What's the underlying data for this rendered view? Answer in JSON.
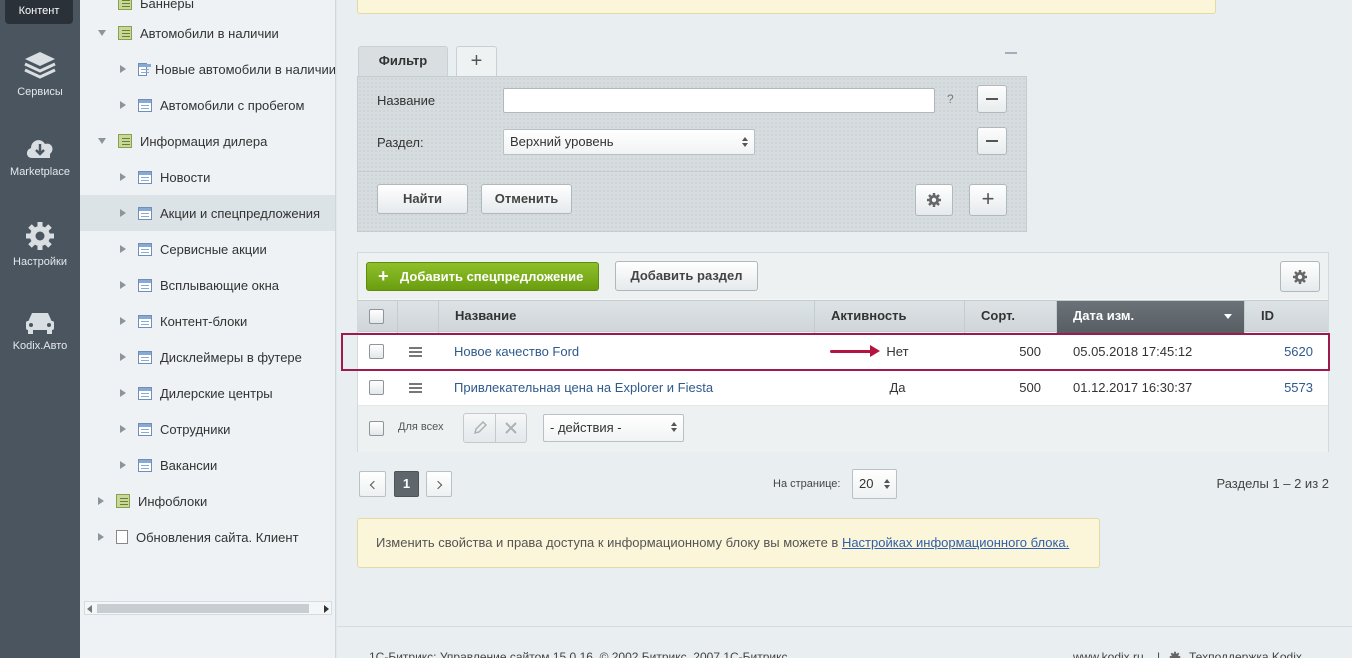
{
  "rail": {
    "active_label": "Контент",
    "items": [
      {
        "label": "Сервисы",
        "icon": "layers-icon"
      },
      {
        "label": "Marketplace",
        "icon": "cloud-download-icon"
      },
      {
        "label": "Настройки",
        "icon": "gear-icon"
      },
      {
        "label": "Kodix.Авто",
        "icon": "car-icon"
      }
    ]
  },
  "tree": {
    "items": [
      {
        "label": "Баннеры"
      },
      {
        "label": "Автомобили в наличии"
      },
      {
        "label": "Новые автомобили в наличии"
      },
      {
        "label": "Автомобили с пробегом"
      },
      {
        "label": "Информация дилера"
      },
      {
        "label": "Новости"
      },
      {
        "label": "Акции и спецпредложения"
      },
      {
        "label": "Сервисные акции"
      },
      {
        "label": "Всплывающие окна"
      },
      {
        "label": "Контент-блоки"
      },
      {
        "label": "Дисклеймеры в футере"
      },
      {
        "label": "Дилерские центры"
      },
      {
        "label": "Сотрудники"
      },
      {
        "label": "Вакансии"
      },
      {
        "label": "Инфоблоки"
      },
      {
        "label": "Обновления сайта. Клиент"
      }
    ]
  },
  "filter": {
    "tab_label": "Фильтр",
    "add_tab": "+",
    "name_label": "Название",
    "name_value": "",
    "help": "?",
    "section_label": "Раздел:",
    "section_value": "Верхний уровень",
    "find_label": "Найти",
    "cancel_label": "Отменить",
    "add_icon": "+"
  },
  "toolbar": {
    "add_offer_label": "Добавить спецпредложение",
    "add_section_label": "Добавить раздел",
    "plus": "+"
  },
  "table": {
    "columns": [
      "Название",
      "Активность",
      "Сорт.",
      "Дата изм.",
      "ID"
    ],
    "rows": [
      {
        "name": "Новое качество Ford",
        "active": "Нет",
        "sort": "500",
        "date": "05.05.2018 17:45:12",
        "id": "5620"
      },
      {
        "name": "Привлекательная цена на Explorer и Fiesta",
        "active": "Да",
        "sort": "500",
        "date": "01.12.2017 16:30:37",
        "id": "5573"
      }
    ],
    "for_all_label": "Для всех",
    "actions_value": "- действия -"
  },
  "pager": {
    "current_page": "1",
    "per_page_label": "На странице:",
    "per_page_value": "20",
    "summary": "Разделы 1 – 2 из 2"
  },
  "note": {
    "text": "Изменить свойства и права доступа к информационному блоку вы можете в ",
    "link": "Настройках информационного блока."
  },
  "footer": {
    "copyright": "1С-Битрикс: Управление сайтом 15.0.16. © 2002 Битрикс, 2007 1С-Битрикс",
    "site": "www.kodix.ru",
    "divider": "|",
    "support": "Техподдержка Kodix"
  },
  "colors": {
    "accent_green": "#7aaf1a",
    "highlight": "#9d1a4e",
    "link": "#2e5a8c"
  }
}
